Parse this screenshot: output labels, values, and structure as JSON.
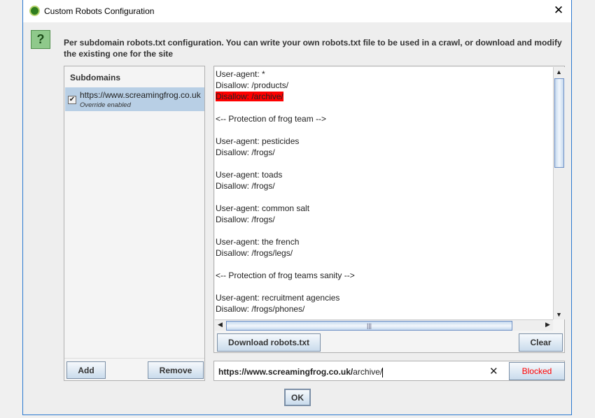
{
  "window": {
    "title": "Custom Robots Configuration",
    "close_icon": "close-icon",
    "app_icon": "frog-icon"
  },
  "description": "Per subdomain robots.txt configuration. You can write your own robots.txt file to be used in a crawl, or download and modify the existing one for the site",
  "subdomains": {
    "header": "Subdomains",
    "items": [
      {
        "url": "https://www.screamingfrog.co.uk",
        "checked": true,
        "status": "Override enabled",
        "selected": true
      }
    ],
    "add_label": "Add",
    "remove_label": "Remove"
  },
  "robots_text": {
    "lines": [
      "User-agent: *",
      "Disallow: /products/",
      "Disallow: /archive/",
      "",
      "<-- Protection of frog team -->",
      "",
      "User-agent: pesticides",
      "Disallow: /frogs/",
      "",
      "User-agent: toads",
      "Disallow: /frogs/",
      "",
      "User-agent: common salt",
      "Disallow: /frogs/",
      "",
      "User-agent: the french",
      "Disallow: /frogs/legs/",
      "",
      "<-- Protection of frog teams sanity -->",
      "",
      "User-agent: recruitment agencies",
      "Disallow: /frogs/phones/"
    ],
    "highlighted_line": 2,
    "highlight_color": "#ff0000"
  },
  "buttons": {
    "download": "Download robots.txt",
    "clear": "Clear",
    "ok": "OK"
  },
  "test": {
    "base_url": "https://www.screamingfrog.co.uk/",
    "path": "archive/",
    "result": "Blocked",
    "result_color": "#ff0000"
  }
}
